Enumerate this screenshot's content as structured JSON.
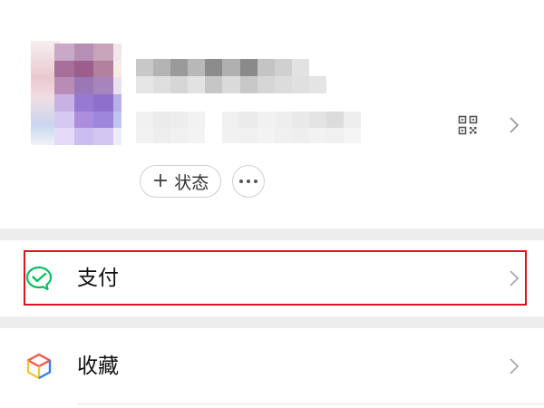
{
  "profile": {
    "status_button": {
      "icon": "plus-icon",
      "label": "状态"
    },
    "more_button": {
      "icon": "more-horizontal-icon"
    },
    "qr_icon": "qr-code-icon",
    "chevron_icon": "chevron-right-icon"
  },
  "menu": {
    "items": [
      {
        "label": "支付",
        "icon": "wechat-pay-icon",
        "highlighted": true
      },
      {
        "label": "收藏",
        "icon": "favorites-cube-icon",
        "highlighted": false
      }
    ]
  },
  "colors": {
    "highlight_border": "#d9141f",
    "pay_green": "#07c160",
    "section_gap": "#ededed",
    "fav_red": "#f4564b",
    "fav_yellow": "#f5c536",
    "fav_blue": "#2f7df6"
  }
}
